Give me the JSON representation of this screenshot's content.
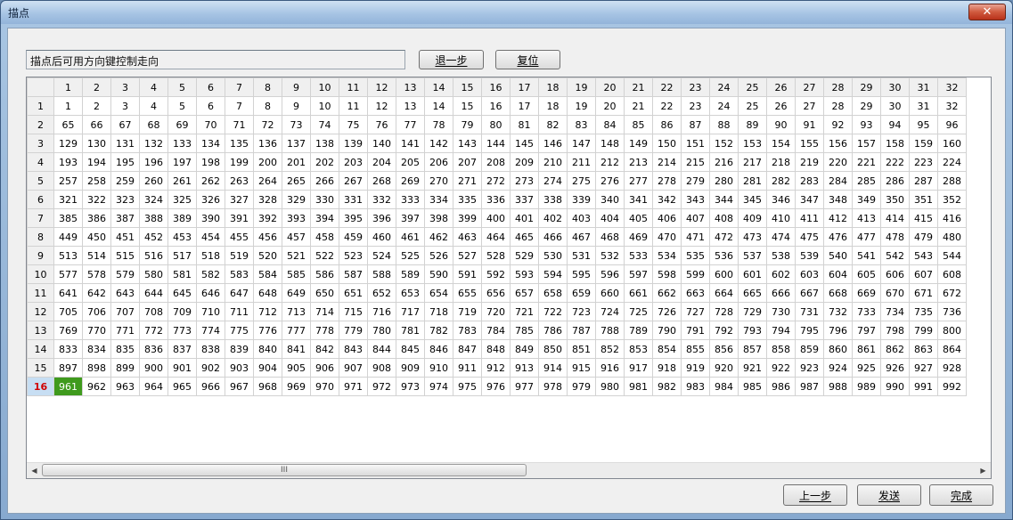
{
  "window": {
    "title": "描点",
    "close_glyph": "✕"
  },
  "hint": {
    "text": "描点后可用方向键控制走向"
  },
  "buttons": {
    "undo_step": "退一步",
    "reset": "复位",
    "prev": "上一步",
    "send": "发送",
    "finish": "完成"
  },
  "grid": {
    "columns": [
      "1",
      "2",
      "3",
      "4",
      "5",
      "6",
      "7",
      "8",
      "9",
      "10",
      "11",
      "12",
      "13",
      "14",
      "15",
      "16",
      "17",
      "18",
      "19",
      "20",
      "21",
      "22",
      "23",
      "24",
      "25",
      "26",
      "27",
      "28",
      "29",
      "30",
      "31",
      "32"
    ],
    "rows": [
      {
        "label": "1",
        "cells": [
          "1",
          "2",
          "3",
          "4",
          "5",
          "6",
          "7",
          "8",
          "9",
          "10",
          "11",
          "12",
          "13",
          "14",
          "15",
          "16",
          "17",
          "18",
          "19",
          "20",
          "21",
          "22",
          "23",
          "24",
          "25",
          "26",
          "27",
          "28",
          "29",
          "30",
          "31",
          "32"
        ]
      },
      {
        "label": "2",
        "cells": [
          "65",
          "66",
          "67",
          "68",
          "69",
          "70",
          "71",
          "72",
          "73",
          "74",
          "75",
          "76",
          "77",
          "78",
          "79",
          "80",
          "81",
          "82",
          "83",
          "84",
          "85",
          "86",
          "87",
          "88",
          "89",
          "90",
          "91",
          "92",
          "93",
          "94",
          "95",
          "96"
        ]
      },
      {
        "label": "3",
        "cells": [
          "129",
          "130",
          "131",
          "132",
          "133",
          "134",
          "135",
          "136",
          "137",
          "138",
          "139",
          "140",
          "141",
          "142",
          "143",
          "144",
          "145",
          "146",
          "147",
          "148",
          "149",
          "150",
          "151",
          "152",
          "153",
          "154",
          "155",
          "156",
          "157",
          "158",
          "159",
          "160"
        ]
      },
      {
        "label": "4",
        "cells": [
          "193",
          "194",
          "195",
          "196",
          "197",
          "198",
          "199",
          "200",
          "201",
          "202",
          "203",
          "204",
          "205",
          "206",
          "207",
          "208",
          "209",
          "210",
          "211",
          "212",
          "213",
          "214",
          "215",
          "216",
          "217",
          "218",
          "219",
          "220",
          "221",
          "222",
          "223",
          "224"
        ]
      },
      {
        "label": "5",
        "cells": [
          "257",
          "258",
          "259",
          "260",
          "261",
          "262",
          "263",
          "264",
          "265",
          "266",
          "267",
          "268",
          "269",
          "270",
          "271",
          "272",
          "273",
          "274",
          "275",
          "276",
          "277",
          "278",
          "279",
          "280",
          "281",
          "282",
          "283",
          "284",
          "285",
          "286",
          "287",
          "288"
        ]
      },
      {
        "label": "6",
        "cells": [
          "321",
          "322",
          "323",
          "324",
          "325",
          "326",
          "327",
          "328",
          "329",
          "330",
          "331",
          "332",
          "333",
          "334",
          "335",
          "336",
          "337",
          "338",
          "339",
          "340",
          "341",
          "342",
          "343",
          "344",
          "345",
          "346",
          "347",
          "348",
          "349",
          "350",
          "351",
          "352"
        ]
      },
      {
        "label": "7",
        "cells": [
          "385",
          "386",
          "387",
          "388",
          "389",
          "390",
          "391",
          "392",
          "393",
          "394",
          "395",
          "396",
          "397",
          "398",
          "399",
          "400",
          "401",
          "402",
          "403",
          "404",
          "405",
          "406",
          "407",
          "408",
          "409",
          "410",
          "411",
          "412",
          "413",
          "414",
          "415",
          "416"
        ]
      },
      {
        "label": "8",
        "cells": [
          "449",
          "450",
          "451",
          "452",
          "453",
          "454",
          "455",
          "456",
          "457",
          "458",
          "459",
          "460",
          "461",
          "462",
          "463",
          "464",
          "465",
          "466",
          "467",
          "468",
          "469",
          "470",
          "471",
          "472",
          "473",
          "474",
          "475",
          "476",
          "477",
          "478",
          "479",
          "480"
        ]
      },
      {
        "label": "9",
        "cells": [
          "513",
          "514",
          "515",
          "516",
          "517",
          "518",
          "519",
          "520",
          "521",
          "522",
          "523",
          "524",
          "525",
          "526",
          "527",
          "528",
          "529",
          "530",
          "531",
          "532",
          "533",
          "534",
          "535",
          "536",
          "537",
          "538",
          "539",
          "540",
          "541",
          "542",
          "543",
          "544"
        ]
      },
      {
        "label": "10",
        "cells": [
          "577",
          "578",
          "579",
          "580",
          "581",
          "582",
          "583",
          "584",
          "585",
          "586",
          "587",
          "588",
          "589",
          "590",
          "591",
          "592",
          "593",
          "594",
          "595",
          "596",
          "597",
          "598",
          "599",
          "600",
          "601",
          "602",
          "603",
          "604",
          "605",
          "606",
          "607",
          "608"
        ]
      },
      {
        "label": "11",
        "cells": [
          "641",
          "642",
          "643",
          "644",
          "645",
          "646",
          "647",
          "648",
          "649",
          "650",
          "651",
          "652",
          "653",
          "654",
          "655",
          "656",
          "657",
          "658",
          "659",
          "660",
          "661",
          "662",
          "663",
          "664",
          "665",
          "666",
          "667",
          "668",
          "669",
          "670",
          "671",
          "672"
        ]
      },
      {
        "label": "12",
        "cells": [
          "705",
          "706",
          "707",
          "708",
          "709",
          "710",
          "711",
          "712",
          "713",
          "714",
          "715",
          "716",
          "717",
          "718",
          "719",
          "720",
          "721",
          "722",
          "723",
          "724",
          "725",
          "726",
          "727",
          "728",
          "729",
          "730",
          "731",
          "732",
          "733",
          "734",
          "735",
          "736"
        ]
      },
      {
        "label": "13",
        "cells": [
          "769",
          "770",
          "771",
          "772",
          "773",
          "774",
          "775",
          "776",
          "777",
          "778",
          "779",
          "780",
          "781",
          "782",
          "783",
          "784",
          "785",
          "786",
          "787",
          "788",
          "789",
          "790",
          "791",
          "792",
          "793",
          "794",
          "795",
          "796",
          "797",
          "798",
          "799",
          "800"
        ]
      },
      {
        "label": "14",
        "cells": [
          "833",
          "834",
          "835",
          "836",
          "837",
          "838",
          "839",
          "840",
          "841",
          "842",
          "843",
          "844",
          "845",
          "846",
          "847",
          "848",
          "849",
          "850",
          "851",
          "852",
          "853",
          "854",
          "855",
          "856",
          "857",
          "858",
          "859",
          "860",
          "861",
          "862",
          "863",
          "864"
        ]
      },
      {
        "label": "15",
        "cells": [
          "897",
          "898",
          "899",
          "900",
          "901",
          "902",
          "903",
          "904",
          "905",
          "906",
          "907",
          "908",
          "909",
          "910",
          "911",
          "912",
          "913",
          "914",
          "915",
          "916",
          "917",
          "918",
          "919",
          "920",
          "921",
          "922",
          "923",
          "924",
          "925",
          "926",
          "927",
          "928"
        ]
      },
      {
        "label": "16",
        "cells": [
          "961",
          "962",
          "963",
          "964",
          "965",
          "966",
          "967",
          "968",
          "969",
          "970",
          "971",
          "972",
          "973",
          "974",
          "975",
          "976",
          "977",
          "978",
          "979",
          "980",
          "981",
          "982",
          "983",
          "984",
          "985",
          "986",
          "987",
          "988",
          "989",
          "990",
          "991",
          "992"
        ]
      }
    ],
    "selected": {
      "row": "16",
      "cell": "961"
    }
  },
  "scrollbar": {
    "left_glyph": "◀",
    "right_glyph": "▶",
    "grip_glyph": "III"
  },
  "colors": {
    "selected_cell": "#3f9a1d",
    "selected_row_header": "#c7def3",
    "selected_row_text": "#d00000"
  }
}
